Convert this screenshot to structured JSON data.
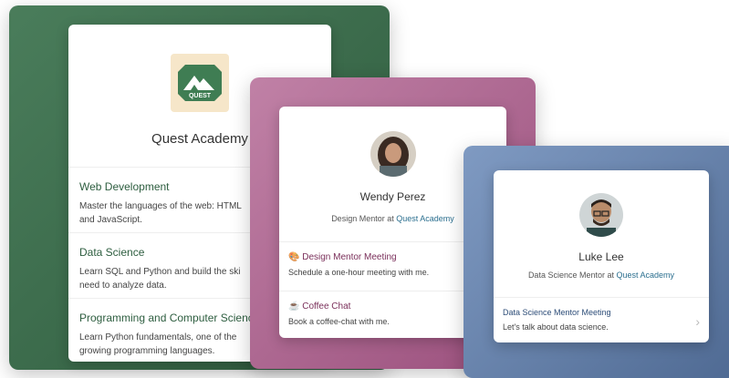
{
  "org": {
    "name": "Quest Academy",
    "logo_text": "QUEST",
    "colors": {
      "panel": "#3b6b4a",
      "title": "#2e5e40"
    },
    "programs": [
      {
        "title": "Web Development",
        "description_line1": "Master the languages of the web: HTML",
        "description_line2": "and JavaScript."
      },
      {
        "title": "Data Science",
        "description_line1": "Learn SQL and Python and build the ski",
        "description_line2": "need to analyze data."
      },
      {
        "title": "Programming and Computer Science",
        "description_line1": "Learn Python fundamentals, one of the",
        "description_line2": "growing programming languages."
      }
    ]
  },
  "mentor1": {
    "name": "Wendy Perez",
    "role_prefix": "Design Mentor at",
    "role_link": "Quest Academy",
    "colors": {
      "panel": "#b06a94",
      "accent": "#7a2f5a"
    },
    "meetings": [
      {
        "icon": "palette-icon",
        "title": "Design Mentor Meeting",
        "description": "Schedule a one-hour meeting with me."
      },
      {
        "icon": "coffee-icon",
        "title": "Coffee Chat",
        "description": "Book a coffee-chat with me."
      }
    ]
  },
  "mentor2": {
    "name": "Luke Lee",
    "role_prefix": "Data Science Mentor at",
    "role_link": "Quest Academy",
    "colors": {
      "panel": "#6d87b0",
      "accent": "#2d4d78"
    },
    "meetings": [
      {
        "title": "Data Science Mentor Meeting",
        "description": "Let's talk about data science.",
        "chevron": "›"
      }
    ]
  }
}
